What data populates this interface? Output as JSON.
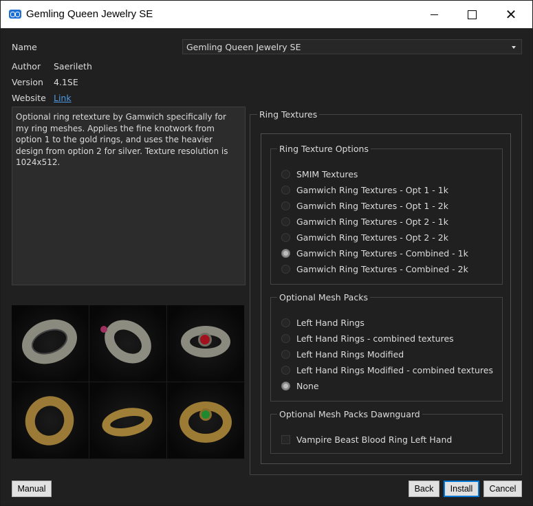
{
  "window": {
    "title": "Gemling Queen Jewelry SE"
  },
  "info": {
    "name_label": "Name",
    "author_label": "Author",
    "author": "Saerileth",
    "version_label": "Version",
    "version": "4.1SE",
    "website_label": "Website",
    "website_link": "Link"
  },
  "name_select": {
    "value": "Gemling Queen Jewelry SE"
  },
  "description": "Optional ring retexture by Gamwich specifically for my ring meshes. Applies the fine knotwork from option 1 to the gold rings, and uses the heavier design from option 2 for silver. Texture resolution is 1024x512.",
  "step": {
    "title": "Ring Textures"
  },
  "groups": [
    {
      "title": "Ring Texture Options",
      "type": "radio",
      "options": [
        {
          "label": "SMIM Textures",
          "selected": false
        },
        {
          "label": "Gamwich Ring Textures - Opt 1 - 1k",
          "selected": false
        },
        {
          "label": "Gamwich Ring Textures - Opt 1 - 2k",
          "selected": false
        },
        {
          "label": "Gamwich Ring Textures - Opt 2 - 1k",
          "selected": false
        },
        {
          "label": "Gamwich Ring Textures - Opt 2 - 2k",
          "selected": false
        },
        {
          "label": "Gamwich Ring Textures - Combined - 1k",
          "selected": true
        },
        {
          "label": "Gamwich Ring Textures - Combined - 2k",
          "selected": false
        }
      ]
    },
    {
      "title": "Optional Mesh Packs",
      "type": "radio",
      "options": [
        {
          "label": "Left Hand Rings",
          "selected": false
        },
        {
          "label": "Left Hand Rings - combined textures",
          "selected": false
        },
        {
          "label": "Left Hand Rings Modified",
          "selected": false
        },
        {
          "label": "Left Hand Rings Modified - combined textures",
          "selected": false
        },
        {
          "label": "None",
          "selected": true
        }
      ]
    },
    {
      "title": "Optional Mesh Packs Dawnguard",
      "type": "checkbox",
      "options": [
        {
          "label": "Vampire Beast Blood Ring Left Hand",
          "selected": false
        }
      ]
    }
  ],
  "buttons": {
    "manual": "Manual",
    "back": "Back",
    "install": "Install",
    "cancel": "Cancel"
  },
  "icons": {
    "app": "mod-organizer-icon",
    "minimize": "minimize-icon",
    "maximize": "maximize-icon",
    "close": "close-icon"
  },
  "colors": {
    "accent": "#0078d7",
    "link": "#4e9be6",
    "background": "#202020"
  }
}
